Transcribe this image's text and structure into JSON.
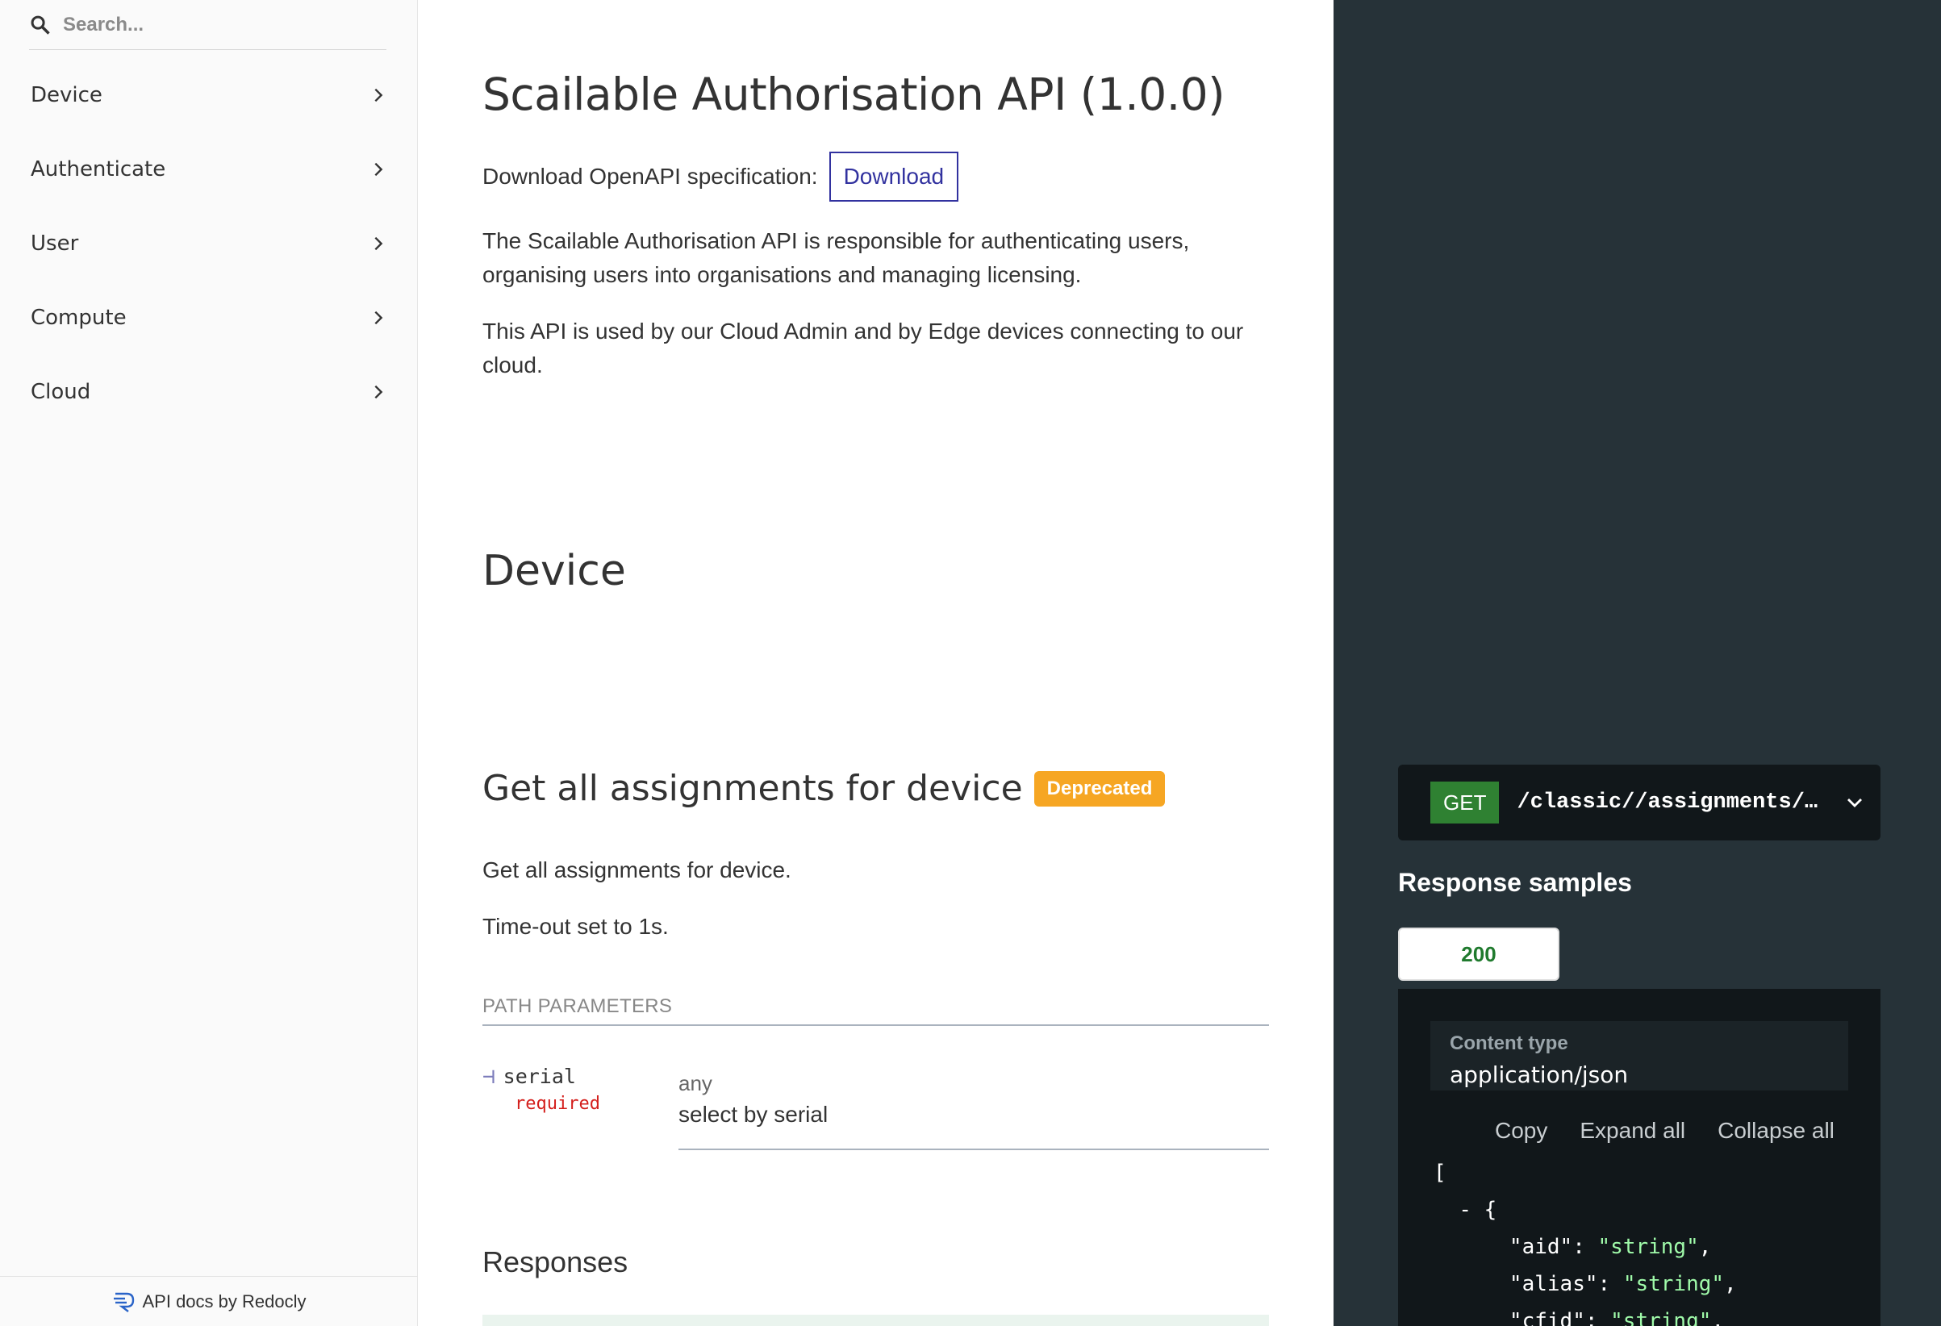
{
  "sidebar": {
    "search_placeholder": "Search...",
    "items": [
      {
        "label": "Device"
      },
      {
        "label": "Authenticate"
      },
      {
        "label": "User"
      },
      {
        "label": "Compute"
      },
      {
        "label": "Cloud"
      }
    ],
    "footer": "API docs by Redocly"
  },
  "main": {
    "title": "Scailable Authorisation API (1.0.0)",
    "download_label": "Download OpenAPI specification:",
    "download_button": "Download",
    "description_1": "The Scailable Authorisation API is responsible for authenticating users, organising users into organisations and managing licensing.",
    "description_2": "This API is used by our Cloud Admin and by Edge devices connecting to our cloud.",
    "section_title": "Device",
    "operation": {
      "title": "Get all assignments for device",
      "badge": "Deprecated",
      "summary": "Get all assignments for device.",
      "timeout": "Time-out set to 1s.",
      "path_params_title": "PATH PARAMETERS",
      "param": {
        "name": "serial",
        "required": "required",
        "type": "any",
        "description": "select by serial"
      },
      "responses_title": "Responses"
    }
  },
  "right_panel": {
    "method": "GET",
    "path": "/classic//assignments/device/{serial}",
    "response_samples_title": "Response samples",
    "status_tab": "200",
    "content_type_label": "Content type",
    "content_type_value": "application/json",
    "actions": {
      "copy": "Copy",
      "expand": "Expand all",
      "collapse": "Collapse all"
    },
    "code": {
      "open_bracket": "[",
      "collapse_marker": "- {",
      "fields": [
        {
          "key": "\"aid\"",
          "value": "\"string\""
        },
        {
          "key": "\"alias\"",
          "value": "\"string\""
        },
        {
          "key": "\"cfid\"",
          "value": "\"string\""
        }
      ]
    }
  },
  "colors": {
    "accent": "#32329f",
    "badge": "#f6a623",
    "get_method": "#2f8132",
    "right_bg": "#263238",
    "required": "#d41f1c",
    "json_string": "#a0fbaa"
  }
}
